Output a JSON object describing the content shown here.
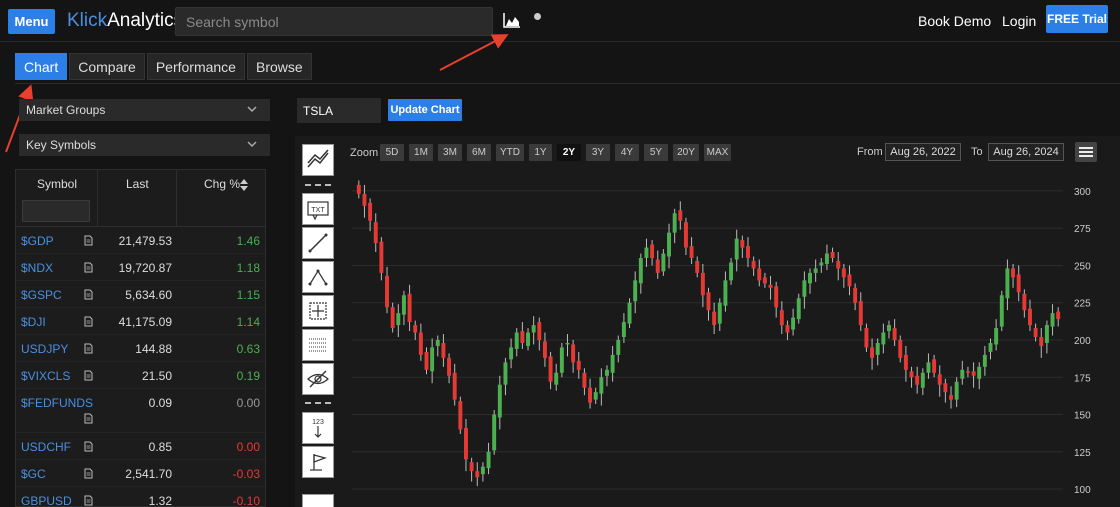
{
  "header": {
    "menu_label": "Menu",
    "logo_part1": "Klick",
    "logo_part2": "Analytics",
    "search_placeholder": "Search symbol",
    "book_demo": "Book Demo",
    "login": "Login",
    "free_trial": "FREE Trial"
  },
  "tabs": [
    "Chart",
    "Compare",
    "Performance",
    "Browse"
  ],
  "sidebar": {
    "dropdown1": "Market Groups",
    "dropdown2": "Key Symbols",
    "columns": [
      "Symbol",
      "Last",
      "Chg %"
    ],
    "rows": [
      {
        "symbol": "$GDP",
        "last": "21,479.53",
        "chg": "1.46",
        "dir": "pos"
      },
      {
        "symbol": "$NDX",
        "last": "19,720.87",
        "chg": "1.18",
        "dir": "pos"
      },
      {
        "symbol": "$GSPC",
        "last": "5,634.60",
        "chg": "1.15",
        "dir": "pos"
      },
      {
        "symbol": "$DJI",
        "last": "41,175.09",
        "chg": "1.14",
        "dir": "pos"
      },
      {
        "symbol": "USDJPY",
        "last": "144.88",
        "chg": "0.63",
        "dir": "pos"
      },
      {
        "symbol": "$VIXCLS",
        "last": "21.50",
        "chg": "0.19",
        "dir": "pos"
      },
      {
        "symbol": "$FEDFUNDS",
        "last": "0.09",
        "chg": "0.00",
        "dir": "zero"
      },
      {
        "symbol": "USDCHF",
        "last": "0.85",
        "chg": "0.00",
        "dir": "neg"
      },
      {
        "symbol": "$GC",
        "last": "2,541.70",
        "chg": "-0.03",
        "dir": "neg"
      },
      {
        "symbol": "GBPUSD",
        "last": "1.32",
        "chg": "-0.10",
        "dir": "neg"
      }
    ]
  },
  "chart_controls": {
    "symbol": "TSLA",
    "update_label": "Update Chart",
    "zoom_label": "Zoom",
    "zoom_options": [
      "5D",
      "1M",
      "3M",
      "6M",
      "YTD",
      "1Y",
      "2Y",
      "3Y",
      "4Y",
      "5Y",
      "20Y",
      "MAX"
    ],
    "zoom_active": "2Y",
    "from_label": "From",
    "from_date": "Aug 26, 2022",
    "to_label": "To",
    "to_date": "Aug 26, 2024"
  },
  "tool_labels": {
    "text_tool": "TXT",
    "count_tool": "123"
  },
  "colors": {
    "accent": "#2d7fe8",
    "up": "#4caf50",
    "down": "#e53935",
    "arrow": "#e8402c"
  },
  "chart_data": {
    "type": "candlestick",
    "symbol": "TSLA",
    "yticks": [
      100,
      125,
      150,
      175,
      200,
      225,
      250,
      275,
      300
    ],
    "ylim": [
      94,
      310
    ],
    "closes": [
      298,
      290,
      280,
      265,
      245,
      222,
      208,
      218,
      230,
      212,
      205,
      190,
      180,
      195,
      200,
      188,
      176,
      160,
      140,
      120,
      112,
      108,
      115,
      125,
      150,
      170,
      185,
      195,
      205,
      198,
      205,
      210,
      200,
      188,
      172,
      178,
      195,
      198,
      185,
      180,
      168,
      158,
      165,
      175,
      180,
      190,
      200,
      212,
      225,
      240,
      255,
      262,
      255,
      245,
      258,
      272,
      285,
      280,
      262,
      255,
      245,
      230,
      220,
      210,
      225,
      240,
      252,
      268,
      262,
      255,
      248,
      240,
      238,
      235,
      222,
      210,
      205,
      215,
      228,
      240,
      245,
      248,
      252,
      258,
      255,
      248,
      242,
      236,
      225,
      210,
      195,
      188,
      198,
      205,
      210,
      200,
      188,
      180,
      175,
      170,
      178,
      185,
      178,
      170,
      165,
      160,
      172,
      180,
      178,
      176,
      182,
      190,
      198,
      208,
      230,
      248,
      242,
      232,
      220,
      210,
      202,
      196,
      210,
      218,
      214
    ]
  }
}
